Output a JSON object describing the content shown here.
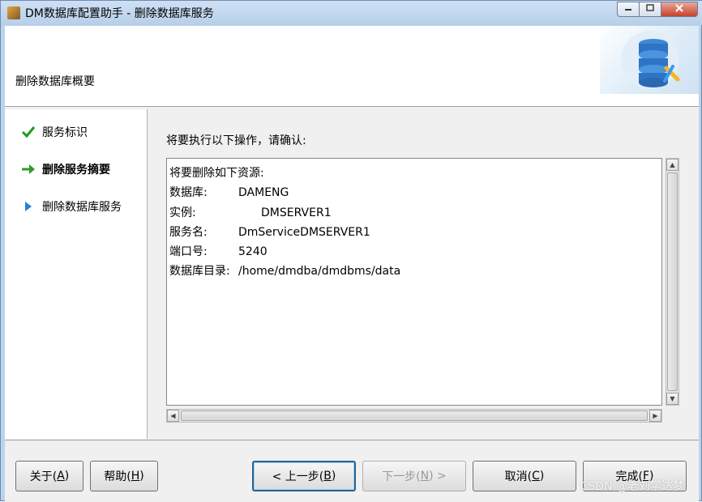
{
  "window": {
    "title": "DM数据库配置助手 - 删除数据库服务",
    "controls": {
      "minimize": "▭",
      "maximize": "□",
      "close": "✕"
    }
  },
  "header": {
    "title": "删除数据库概要"
  },
  "nav": {
    "items": [
      {
        "label": "服务标识",
        "state": "done",
        "icon": "check-icon"
      },
      {
        "label": "删除服务摘要",
        "state": "current",
        "icon": "arrow-right-icon"
      },
      {
        "label": "删除数据库服务",
        "state": "pending",
        "icon": "triangle-right-icon"
      }
    ]
  },
  "main": {
    "instruction": "将要执行以下操作，请确认:",
    "summary": {
      "intro": "将要删除如下资源:",
      "rows": [
        {
          "key": "数据库:",
          "value": "DAMENG"
        },
        {
          "key": "实例:",
          "value": "DMSERVER1"
        },
        {
          "key": "服务名:",
          "value": "DmServiceDMSERVER1"
        },
        {
          "key": "端口号:",
          "value": "5240"
        },
        {
          "key": "数据库目录:",
          "value": "/home/dmdba/dmdbms/data"
        }
      ]
    }
  },
  "footer": {
    "about": {
      "label": "关于(",
      "key": "A",
      "end": ")"
    },
    "help": {
      "label": "帮助(",
      "key": "H",
      "end": ")"
    },
    "prev": {
      "label": "< 上一步(",
      "key": "B",
      "end": ")"
    },
    "next": {
      "label": "下一步(",
      "key": "N",
      "end": ") >"
    },
    "cancel": {
      "label": "取消(",
      "key": "C",
      "end": ")"
    },
    "finish": {
      "label": "完成(",
      "key": "F",
      "end": ")"
    }
  },
  "watermark": "CSDN @老刘学达梦",
  "colors": {
    "check": "#1f9a1f",
    "arrow": "#2f9a2f",
    "triangle": "#2a7fd6",
    "titlebar": "#bcd3ec"
  }
}
